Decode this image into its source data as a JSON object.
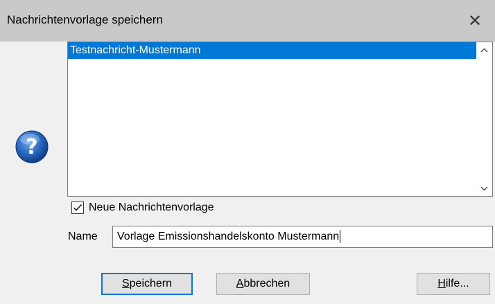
{
  "window": {
    "title": "Nachrichtenvorlage speichern",
    "close_symbol": "✕"
  },
  "list": {
    "items": [
      {
        "label": "Testnachricht-Mustermann",
        "selected": true
      }
    ]
  },
  "checkbox": {
    "label": "Neue Nachrichtenvorlage",
    "checked": true
  },
  "name_field": {
    "label": "Name",
    "value": "Vorlage Emissionshandelskonto Mustermann"
  },
  "buttons": {
    "save": {
      "access_key": "S",
      "rest": "peichern"
    },
    "cancel": {
      "access_key": "A",
      "rest": "bbrechen"
    },
    "help": {
      "access_key": "H",
      "rest": "ilfe..."
    }
  },
  "colors": {
    "selection": "#0078d7",
    "title_bar": "#c9c9c9",
    "help_icon": "#1f5fb0"
  },
  "icons": [
    "help-icon",
    "close-icon",
    "scroll-up-icon",
    "scroll-down-icon",
    "checkmark-icon"
  ]
}
